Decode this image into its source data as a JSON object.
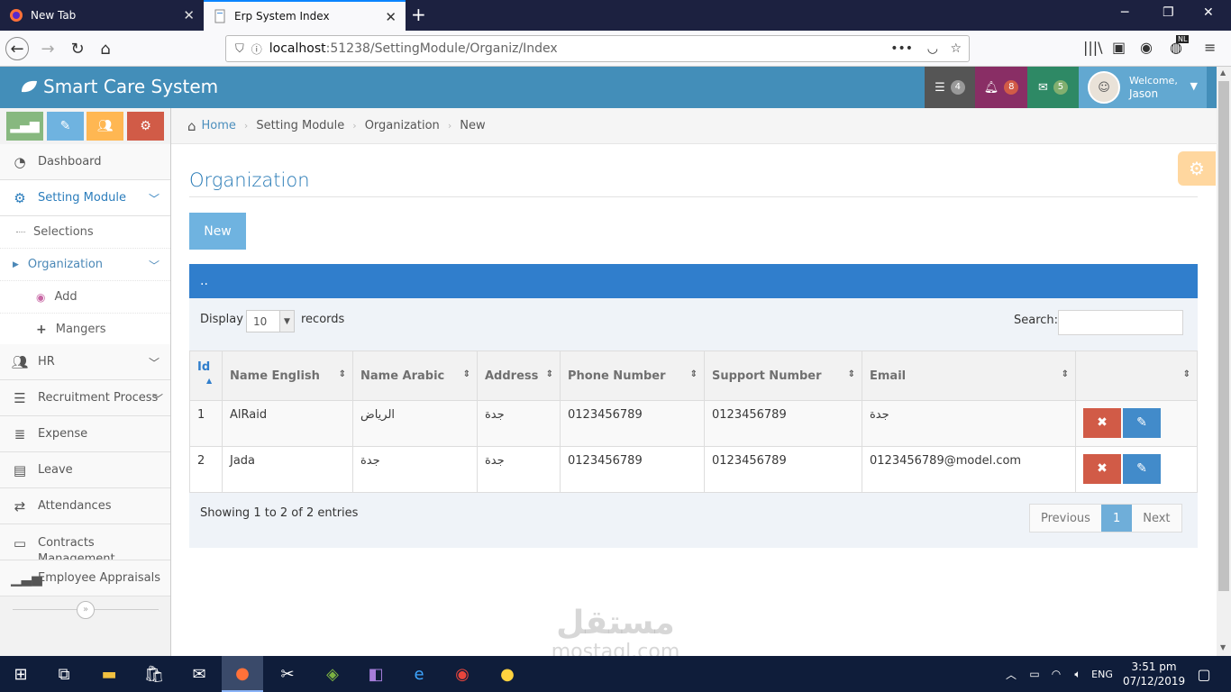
{
  "browser": {
    "tabs": [
      {
        "title": "New Tab"
      },
      {
        "title": "Erp System Index"
      }
    ],
    "url_main": "localhost",
    "url_rest": ":51238/SettingModule/Organiz/Index",
    "ext_badge": "NL"
  },
  "header": {
    "brand": "Smart Care System",
    "tasks_count": "4",
    "notifications_count": "8",
    "messages_count": "5",
    "welcome": "Welcome,",
    "user_name": "Jason",
    "colors": {
      "header_bg": "#438eb9",
      "tasks_bg": "#555555",
      "notif_bg": "#892e65",
      "msg_bg": "#2e8965"
    }
  },
  "sidebar": {
    "items": [
      {
        "label": "Dashboard",
        "icon": "tachometer-icon"
      },
      {
        "label": "Setting Module",
        "icon": "cogs-icon"
      },
      {
        "label": "Selections"
      },
      {
        "label": "Organization"
      },
      {
        "label": "Add",
        "icon": "eye-icon"
      },
      {
        "label": "Mangers",
        "icon": "plus-icon"
      },
      {
        "label": "HR",
        "icon": "users-icon"
      },
      {
        "label": "Recruitment Process",
        "icon": "list-icon"
      },
      {
        "label": "Expense",
        "icon": "align-justify-icon"
      },
      {
        "label": "Leave",
        "icon": "list-alt-icon"
      },
      {
        "label": "Attendances",
        "icon": "exchange-icon"
      },
      {
        "label": "Contracts Management",
        "icon": "credit-card-icon"
      },
      {
        "label": "Employee Appraisals",
        "icon": "signal-icon"
      }
    ]
  },
  "breadcrumb": [
    "Home",
    "Setting Module",
    "Organization",
    "New"
  ],
  "main": {
    "title": "Organization",
    "new_label": "New",
    "table_caption": "..",
    "display_label": "Display",
    "records_value": "10",
    "records_label": "records",
    "search_label": "Search:",
    "columns": [
      "Id",
      "Name English",
      "Name Arabic",
      "Address",
      "Phone Number",
      "Support Number",
      "Email",
      ""
    ],
    "rows": [
      {
        "id": "1",
        "name_en": "AlRaid",
        "name_ar": "الرياض",
        "address": "جدة",
        "phone": "0123456789",
        "support": "0123456789",
        "email": "جدة"
      },
      {
        "id": "2",
        "name_en": "Jada",
        "name_ar": "جدة",
        "address": "جدة",
        "phone": "0123456789",
        "support": "0123456789",
        "email": "0123456789@model.com"
      }
    ],
    "showing": "Showing 1 to 2 of 2 entries",
    "pager": {
      "prev": "Previous",
      "page": "1",
      "next": "Next"
    }
  },
  "taskbar": {
    "time": "3:51 pm",
    "date": "07/12/2019",
    "lang": "ENG"
  },
  "watermark": {
    "arabic": "مستقل",
    "latin": "mostaql.com"
  }
}
